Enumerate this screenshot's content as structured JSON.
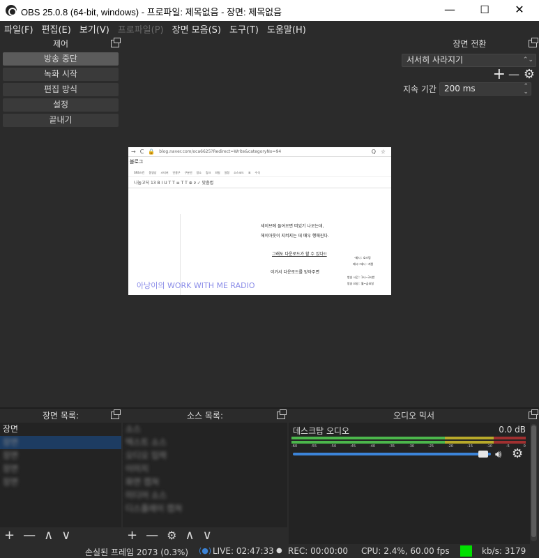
{
  "window": {
    "title": "OBS 25.0.8 (64-bit, windows) - 프로파일: 제목없음 - 장면: 제목없음",
    "minimize": "—",
    "maximize": "☐",
    "close": "✕"
  },
  "menu": {
    "items": [
      {
        "label": "파일(F)",
        "enabled": true
      },
      {
        "label": "편집(E)",
        "enabled": true
      },
      {
        "label": "보기(V)",
        "enabled": true
      },
      {
        "label": "프로파일(P)",
        "enabled": false
      },
      {
        "label": "장면 모음(S)",
        "enabled": true
      },
      {
        "label": "도구(T)",
        "enabled": true
      },
      {
        "label": "도움말(H)",
        "enabled": true
      }
    ]
  },
  "controls": {
    "title": "제어",
    "stop_streaming": "방송 중단",
    "start_recording": "녹화 시작",
    "studio_mode": "편집 방식",
    "settings": "설정",
    "exit": "끝내기"
  },
  "transitions": {
    "title": "장면 전환",
    "selected": "서서히 사라지기",
    "add": "+",
    "remove": "—",
    "duration_label": "지속 기간",
    "duration_value": "200 ms"
  },
  "preview": {
    "browser_url": "blog.naver.com/oca6625?Redirect=Write&categoryNo=94",
    "blog_label": "블로그",
    "editor_tools": [
      "SNS스킨",
      "동영상",
      "스티커",
      "인용구",
      "구분선",
      "장소",
      "링크",
      "파일",
      "일정",
      "소스코드",
      "표",
      "수식"
    ],
    "format_bar": "나눔고딕  13  B  I  U  T  T  ≡  T  T  ⊕  ∂  ✓ 맞춤법",
    "lines": [
      "세이브에 들어오면 떠있기 나오는데,",
      "헤이아웃이 지켜지는 데 매우 행해진다.",
      "그래도 다운로드가 할 수 있다!!",
      "이거서 다운로드를 받아주면"
    ],
    "side_lines": [
      "-제시 : 호스팅",
      "제시~제시 : 지원",
      "방송 시간 : 1시~3시반",
      "방송 요일 : 월~금요일"
    ],
    "radio_name": "아낭이의 WORK WITH ME RADIO"
  },
  "scenes": {
    "title": "장면 목록:",
    "items": [
      "장면",
      "장면",
      "장면",
      "장면",
      "장면"
    ]
  },
  "sources": {
    "title": "소스 목록:",
    "items": [
      "소스",
      "텍스트 소스",
      "오디오 입력",
      "이미지",
      "화면 캡쳐",
      "미디어 소스",
      "디스플레이 캡쳐"
    ]
  },
  "mixer": {
    "title": "오디오 믹서",
    "track_name": "데스크탑 오디오",
    "level": "0.0 dB",
    "ticks": [
      "-60",
      "-55",
      "-50",
      "-45",
      "-40",
      "-35",
      "-30",
      "-25",
      "-20",
      "-15",
      "-10",
      "-5",
      "0"
    ],
    "volume_fraction": 0.96
  },
  "status": {
    "dropped": "손실된 프레임 2073 (0.3%)",
    "live": "LIVE: 02:47:33",
    "rec": "REC: 00:00:00",
    "cpu": "CPU: 2.4%, 60.00 fps",
    "kbps": "kb/s: 3179",
    "health_color": "#00e000"
  },
  "colors": {
    "accent_blue": "#3c84d8",
    "meter_green": "#4cb74c",
    "meter_yellow": "#d7c52b",
    "meter_red": "#c03a3a"
  }
}
